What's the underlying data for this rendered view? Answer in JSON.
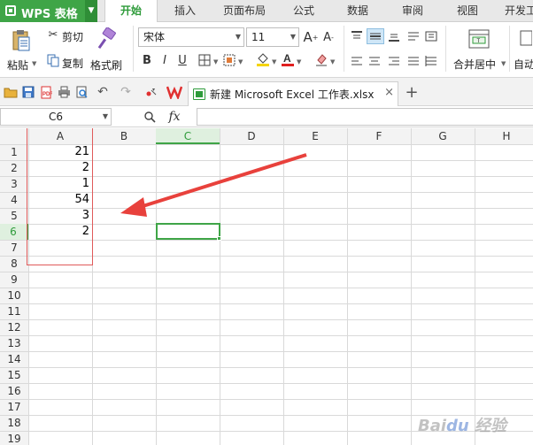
{
  "app": {
    "name": "WPS 表格"
  },
  "ribbon_tabs": [
    "开始",
    "插入",
    "页面布局",
    "公式",
    "数据",
    "审阅",
    "视图",
    "开发工"
  ],
  "clipboard": {
    "paste": "粘贴",
    "cut": "剪切",
    "copy": "复制",
    "format_painter": "格式刷"
  },
  "font": {
    "name": "宋体",
    "size": "11",
    "bold": "B",
    "italic": "I",
    "underline": "U"
  },
  "alignment": {
    "merge_center": "合并居中",
    "auto_wrap": "自动"
  },
  "document_tab": {
    "filename": "新建 Microsoft Excel 工作表.xlsx"
  },
  "formula_bar": {
    "cell_ref": "C6",
    "fx": "fx",
    "content": ""
  },
  "grid": {
    "columns": [
      "A",
      "B",
      "C",
      "D",
      "E",
      "F",
      "G",
      "H"
    ],
    "rows": [
      "1",
      "2",
      "3",
      "4",
      "5",
      "6",
      "7",
      "8",
      "9",
      "10",
      "11",
      "12",
      "13",
      "14",
      "15",
      "16",
      "17",
      "18",
      "19"
    ],
    "column_a_values": [
      "21",
      "2",
      "1",
      "54",
      "3",
      "2"
    ],
    "active_cell": "C6",
    "annotation": {
      "outline_color": "#e05a5a",
      "arrow_color": "#e8413c"
    }
  },
  "colors": {
    "accent_green": "#3fa547",
    "active_tab_text": "#2e9b3a",
    "selection_green": "#3fa547"
  }
}
